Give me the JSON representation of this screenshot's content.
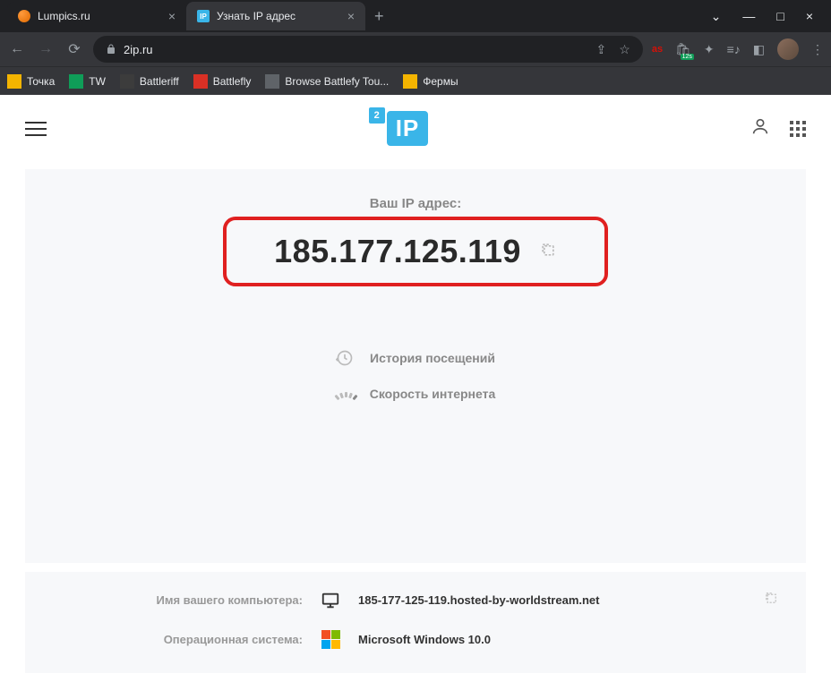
{
  "tabs": [
    {
      "title": "Lumpics.ru",
      "favicon": "orange"
    },
    {
      "title": "Узнать IP адрес",
      "favicon": "ip"
    }
  ],
  "url": "2ip.ru",
  "bookmarks": [
    {
      "label": "Точка",
      "color": "#f4b400"
    },
    {
      "label": "TW",
      "color": "#0f9d58"
    },
    {
      "label": "Battleriff",
      "color": "#5f6368"
    },
    {
      "label": "Battlefly",
      "color": "#d93025"
    },
    {
      "label": "Browse Battlefy Tou...",
      "color": "#5f6368"
    },
    {
      "label": "Фермы",
      "color": "#f4b400"
    }
  ],
  "site": {
    "ip_label": "Ваш IP адрес:",
    "ip_value": "185.177.125.119",
    "links": {
      "history": "История посещений",
      "speed": "Скорость интернета"
    },
    "info": {
      "computer_label": "Имя вашего компьютера:",
      "computer_value": "185-177-125-119.hosted-by-worldstream.net",
      "os_label": "Операционная система:",
      "os_value": "Microsoft Windows 10.0"
    }
  }
}
